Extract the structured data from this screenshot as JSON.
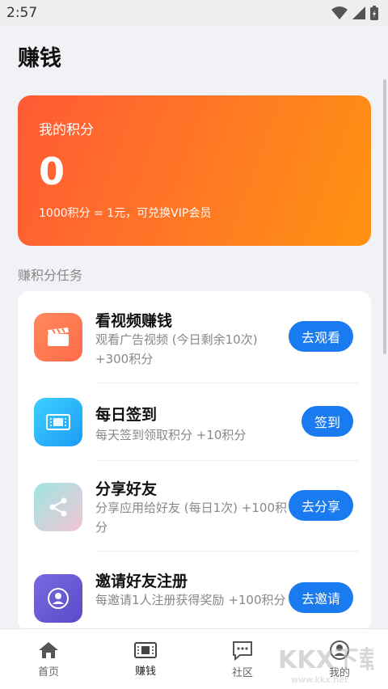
{
  "status_bar": {
    "time": "2:57"
  },
  "page": {
    "title": "赚钱"
  },
  "points_card": {
    "label": "我的积分",
    "value": "0",
    "note": "1000积分 = 1元，可兑换VIP会员"
  },
  "section": {
    "label": "赚积分任务"
  },
  "tasks": [
    {
      "title": "看视频赚钱",
      "desc": "观看广告视频 (今日剩余10次) +300积分",
      "button": "去观看",
      "icon": "clapperboard-icon",
      "color": "#ff7a4c"
    },
    {
      "title": "每日签到",
      "desc": "每天签到领取积分 +10积分",
      "button": "签到",
      "icon": "ticket-icon",
      "color": "#27b6ff"
    },
    {
      "title": "分享好友",
      "desc": "分享应用给好友 (每日1次) +100积分",
      "button": "去分享",
      "icon": "share-icon",
      "color": "#a6e4e6"
    },
    {
      "title": "邀请好友注册",
      "desc": "每邀请1人注册获得奖励 +100积分",
      "button": "去邀请",
      "icon": "user-icon",
      "color": "#6a5ad8"
    }
  ],
  "nav": [
    {
      "label": "首页",
      "icon": "home-icon"
    },
    {
      "label": "赚钱",
      "icon": "ticket-icon"
    },
    {
      "label": "社区",
      "icon": "chat-icon"
    },
    {
      "label": "我的",
      "icon": "profile-icon"
    }
  ],
  "watermark": {
    "text": "KKX下载",
    "url_text": "www.kkx.net"
  },
  "colors": {
    "accent": "#1a7bf0",
    "card_start": "#ff5a34",
    "card_end": "#ff9210"
  }
}
